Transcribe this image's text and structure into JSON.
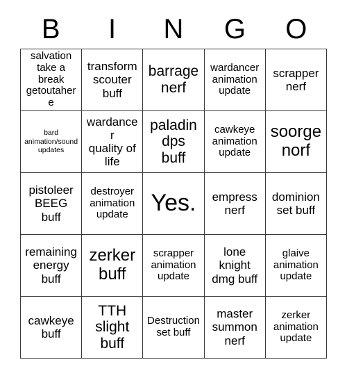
{
  "card": {
    "header_letters": [
      "B",
      "I",
      "N",
      "G",
      "O"
    ],
    "grid_columns": 5,
    "grid_rows": 5,
    "colors": {
      "background": "#ffffff",
      "text": "#000000",
      "border": "#3a3a3a"
    },
    "cells": [
      {
        "text": "salvation\ntake a\nbreak\ngetoutahere",
        "size": "size-sm"
      },
      {
        "text": "transform\nscouter\nbuff",
        "size": "size-md"
      },
      {
        "text": "barrage\nnerf",
        "size": "size-lg"
      },
      {
        "text": "wardancer\nanimation\nupdate",
        "size": "size-sm"
      },
      {
        "text": "scrapper\nnerf",
        "size": "size-md"
      },
      {
        "text": "bard\nanimation/sound\nupdates",
        "size": "size-xs"
      },
      {
        "text": "wardancer\nquality of\nlife",
        "size": "size-md"
      },
      {
        "text": "paladin\ndps\nbuff",
        "size": "size-lg"
      },
      {
        "text": "cawkeye\nanimation\nupdate",
        "size": "size-sm"
      },
      {
        "text": "soorge\nnorf",
        "size": "size-xl"
      },
      {
        "text": "pistoleer\nBEEG\nbuff",
        "size": "size-md"
      },
      {
        "text": "destroyer\nanimation\nupdate",
        "size": "size-sm"
      },
      {
        "text": "Yes.",
        "size": "size-xxl"
      },
      {
        "text": "empress\nnerf",
        "size": "size-md"
      },
      {
        "text": "dominion\nset buff",
        "size": "size-md"
      },
      {
        "text": "remaining\nenergy\nbuff",
        "size": "size-md"
      },
      {
        "text": "zerker\nbuff",
        "size": "size-xl"
      },
      {
        "text": "scrapper\nanimation\nupdate",
        "size": "size-sm"
      },
      {
        "text": "lone\nknight\ndmg buff",
        "size": "size-md"
      },
      {
        "text": "glaive\nanimation\nupdate",
        "size": "size-sm"
      },
      {
        "text": "cawkeye\nbuff",
        "size": "size-md"
      },
      {
        "text": "TTH\nslight\nbuff",
        "size": "size-lg"
      },
      {
        "text": "Destruction\nset buff",
        "size": "size-sm"
      },
      {
        "text": "master\nsummon\nnerf",
        "size": "size-md"
      },
      {
        "text": "zerker\nanimation\nupdate",
        "size": "size-sm"
      }
    ]
  }
}
